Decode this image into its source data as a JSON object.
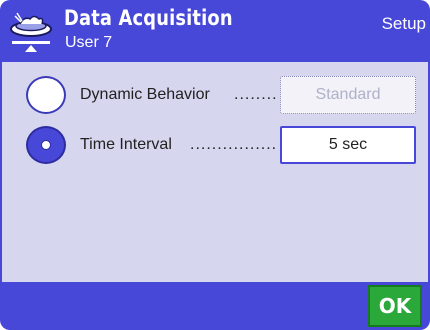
{
  "header": {
    "icon": "balance-data-icon",
    "title": "Data Acquisition",
    "user": "User 7",
    "mode": "Setup"
  },
  "rows": [
    {
      "label": "Dynamic Behavior",
      "dots": "........",
      "value": "Standard",
      "selected": false,
      "enabled": false
    },
    {
      "label": "Time Interval",
      "dots": "................",
      "value": "5 sec",
      "selected": true,
      "enabled": true
    }
  ],
  "footer": {
    "ok_label": "OK"
  },
  "colors": {
    "header_bg": "#4848d8",
    "content_bg": "#d6d6ef",
    "ok_bg": "#2aa83a"
  }
}
